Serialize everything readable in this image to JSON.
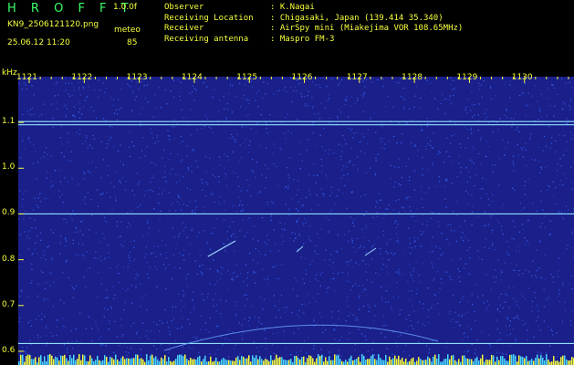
{
  "header": {
    "app_title": "H R O F F T",
    "version": "1.0.0f",
    "filename": "KN9_2506121120.png",
    "mode_label": "meteo",
    "datetime": "25.06.12 11:20",
    "mode_value": "85"
  },
  "info": [
    {
      "label": "Observer",
      "value": ": K.Nagai"
    },
    {
      "label": "Receiving Location",
      "value": ": Chigasaki, Japan (139.414 35.340)"
    },
    {
      "label": "Receiver",
      "value": ": AirSpy mini (Miakejima VOR 108.65MHz)"
    },
    {
      "label": "Receiving antenna",
      "value": ": Maspro FM-3"
    }
  ],
  "chart_data": {
    "type": "heatmap",
    "ylabel": "kHz",
    "x_ticks": [
      "1121",
      "1122",
      "1123",
      "1124",
      "1125",
      "1126",
      "1127",
      "1128",
      "1129",
      "1130"
    ],
    "y_ticks": [
      "1.1",
      "1.0",
      "0.9",
      "0.8",
      "0.7",
      "0.6"
    ],
    "y_tick_values": [
      1.1,
      1.0,
      0.9,
      0.8,
      0.7,
      0.6
    ],
    "xlim": [
      1120.8,
      1130.9
    ],
    "ylim": [
      0.57,
      1.2
    ],
    "horizontal_lines_khz": [
      1.102,
      1.095,
      0.9,
      0.617
    ],
    "colors": {
      "background": "#1a1f8a",
      "noise": "#3b6cff",
      "line": "#8fe0ff",
      "label": "#f6ff3c",
      "title": "#39ff6a"
    }
  }
}
